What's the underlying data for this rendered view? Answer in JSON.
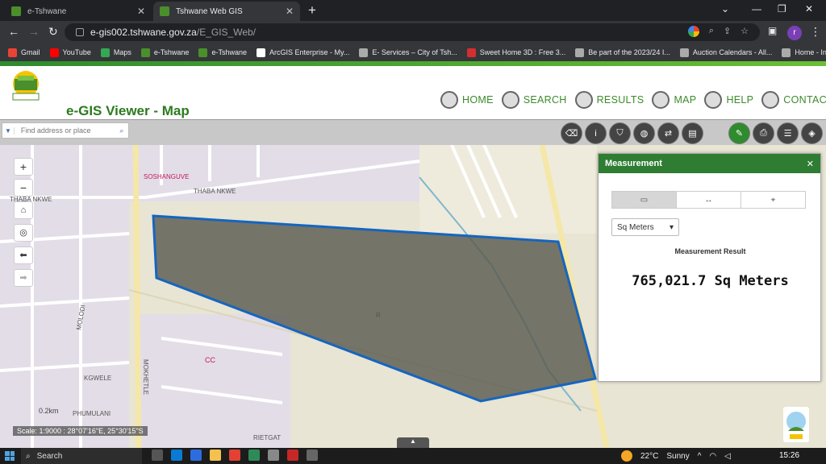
{
  "browser": {
    "tabs": [
      {
        "title": "e-Tshwane",
        "close": "✕"
      },
      {
        "title": "Tshwane Web GIS",
        "close": "✕"
      }
    ],
    "new_tab": "+",
    "url_host": "e-gis002.tshwane.gov.za",
    "url_path": "/E_GIS_Web/",
    "profile_initial": "r",
    "bookmarks": [
      "Gmail",
      "YouTube",
      "Maps",
      "e-Tshwane",
      "e-Tshwane",
      "ArcGIS Enterprise - My...",
      "E- Services – City of Tsh...",
      "Sweet Home 3D : Free 3...",
      "Be part of the 2023/24 I...",
      "Auction Calendars - All...",
      "Home - Investor Relatio..."
    ]
  },
  "site": {
    "app_title": "e-GIS Viewer - Map",
    "nav": [
      "HOME",
      "SEARCH",
      "RESULTS",
      "MAP",
      "HELP",
      "CONTACT"
    ]
  },
  "map_toolbar": {
    "search_placeholder": "Find address or place"
  },
  "map": {
    "labels": [
      "SOSHANGUVE",
      "THABA NKWE",
      "THABA NKWE",
      "MOLODI",
      "KGWELE",
      "MOKHETLE",
      "CC",
      "R",
      "RIETGAT",
      "PHUMULANI"
    ],
    "scale_text": "Scale: 1:9000 : 28°07'16\"E, 25°30'15\"S",
    "scale_bar_label": "0.2km",
    "polygon_color": "#1565c0",
    "polygon_fill": "#5a5a50"
  },
  "measurement": {
    "title": "Measurement",
    "unit": "Sq Meters",
    "result_label": "Measurement Result",
    "result": "765,021.7 Sq Meters"
  },
  "taskbar": {
    "search": "Search",
    "weather": "22°C",
    "weather_desc": "Sunny",
    "time": "15:26"
  }
}
